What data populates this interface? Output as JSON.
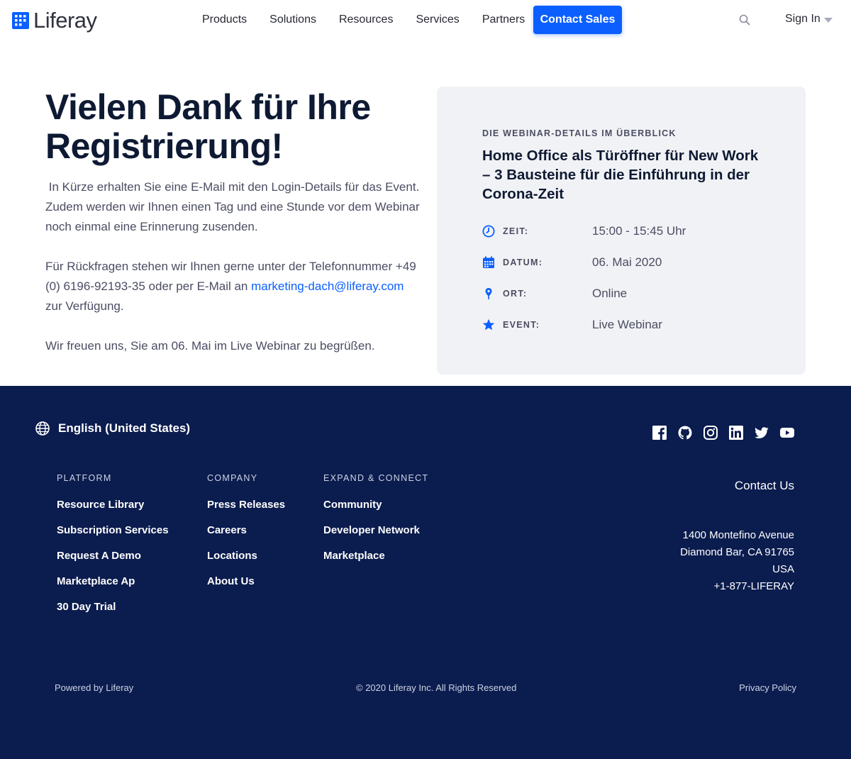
{
  "header": {
    "logo_text": "Liferay",
    "nav": [
      "Products",
      "Solutions",
      "Resources",
      "Services",
      "Partners"
    ],
    "contact_sales": "Contact Sales",
    "sign_in": "Sign In"
  },
  "main": {
    "title": "Vielen Dank für Ihre Registrierung!",
    "p1": " In Kürze erhalten Sie eine E-Mail mit den Login-Details für das Event. Zudem werden wir Ihnen einen Tag und eine Stunde vor dem Webinar noch einmal eine Erinnerung zusenden.",
    "p2_before": "Für Rückfragen stehen wir Ihnen gerne unter der Telefonnummer +49 (0) 6196-92193-35 oder per E-Mail an ",
    "p2_link": "marketing-dach@liferay.com",
    "p2_after": " zur Verfügung.",
    "p3": "Wir freuen uns, Sie am 06. Mai im Live Webinar zu begrüßen."
  },
  "card": {
    "eyebrow": "DIE WEBINAR-DETAILS IM ÜBERBLICK",
    "title": "Home Office als Türöffner für New Work – 3 Bausteine für die Einführung in der Corona-Zeit",
    "details": [
      {
        "icon": "clock-icon",
        "label": "ZEIT:",
        "value": "15:00 - 15:45 Uhr"
      },
      {
        "icon": "calendar-icon",
        "label": "DATUM:",
        "value": "06. Mai 2020"
      },
      {
        "icon": "location-pin-icon",
        "label": "ORT:",
        "value": "Online"
      },
      {
        "icon": "star-icon",
        "label": "EVENT:",
        "value": "Live Webinar"
      }
    ]
  },
  "footer": {
    "language": "English (United States)",
    "columns": [
      {
        "heading": "PLATFORM",
        "links": [
          "Resource Library",
          "Subscription Services",
          "Request A Demo",
          "Marketplace Ap",
          "30 Day Trial"
        ]
      },
      {
        "heading": "COMPANY",
        "links": [
          "Press Releases",
          "Careers",
          "Locations",
          "About Us"
        ]
      },
      {
        "heading": "EXPAND & CONNECT",
        "links": [
          "Community",
          "Developer Network",
          "Marketplace"
        ]
      }
    ],
    "contact_us": "Contact Us",
    "address": [
      "1400 Montefino Avenue",
      "Diamond Bar, CA 91765",
      "USA",
      "+1-877-LIFERAY"
    ],
    "powered_by": "Powered by Liferay",
    "copyright": "© 2020 Liferay Inc. All Rights Reserved",
    "privacy": "Privacy Policy"
  },
  "colors": {
    "accent": "#0b5fff",
    "footer_bg": "#0b1c4e",
    "card_bg": "#f1f2f5"
  }
}
